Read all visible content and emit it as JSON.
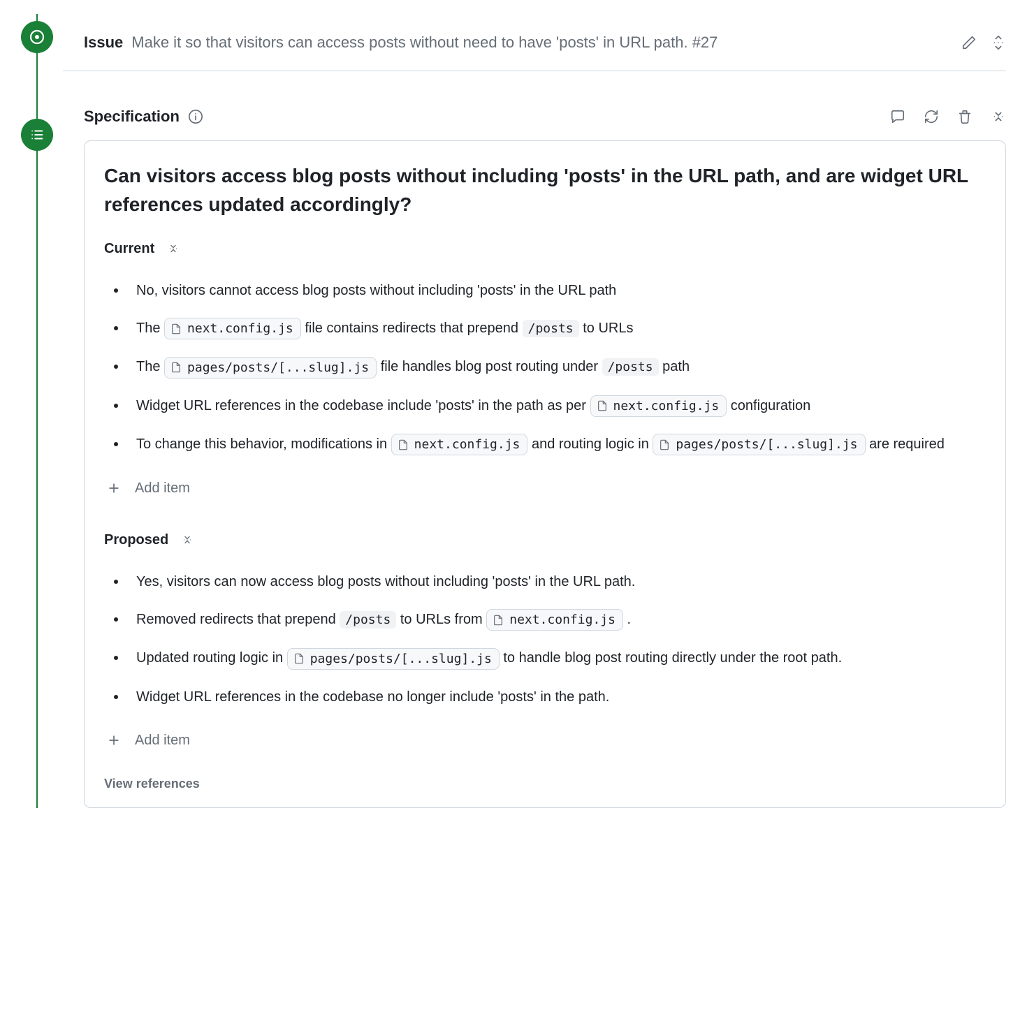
{
  "issue": {
    "label": "Issue",
    "title": "Make it so that visitors can access posts without need to have 'posts' in URL path. #27"
  },
  "spec": {
    "label": "Specification",
    "title": "Can visitors access blog posts without including 'posts' in the URL path, and are widget URL references updated accordingly?",
    "current_label": "Current",
    "proposed_label": "Proposed",
    "add_item_label": "Add item",
    "view_refs_label": "View references",
    "files": {
      "nextConfig": "next.config.js",
      "slugPage": "pages/posts/[...slug].js"
    },
    "paths": {
      "posts": "/posts"
    },
    "current": {
      "i0": "No, visitors cannot access blog posts without including 'posts' in the URL path",
      "i1a": "The ",
      "i1b": " file contains redirects that prepend ",
      "i1c": " to URLs",
      "i2a": "The ",
      "i2b": " file handles blog post routing under ",
      "i2c": " path",
      "i3a": "Widget URL references in the codebase include 'posts' in the path as per ",
      "i3b": " configuration",
      "i4a": "To change this behavior, modifications in ",
      "i4b": " and routing logic in ",
      "i4c": " are required"
    },
    "proposed": {
      "p0": "Yes, visitors can now access blog posts without including 'posts' in the URL path.",
      "p1a": "Removed redirects that prepend ",
      "p1b": " to URLs from ",
      "p1c": ".",
      "p2a": "Updated routing logic in ",
      "p2b": " to handle blog post routing directly under the root path.",
      "p3": "Widget URL references in the codebase no longer include 'posts' in the path."
    }
  }
}
